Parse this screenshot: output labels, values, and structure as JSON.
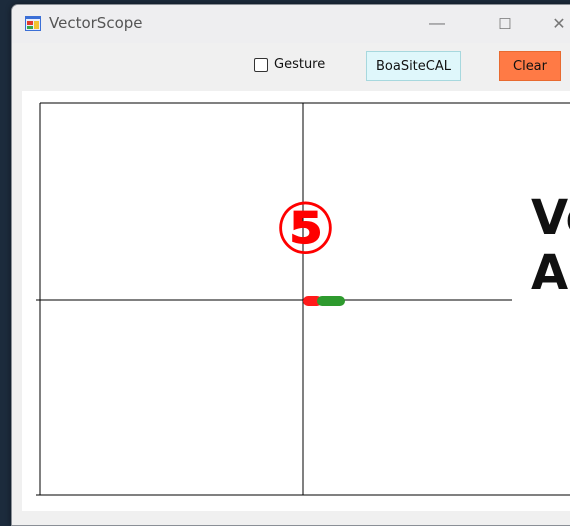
{
  "window": {
    "title": "VectorScope",
    "minimize_glyph": "—",
    "maximize_glyph": "☐",
    "close_glyph": "✕"
  },
  "toolbar": {
    "gesture_checkbox": {
      "label": "Gesture",
      "checked": false
    },
    "cal_button_label": "BoaSiteCAL",
    "clear_button_label": "Clear"
  },
  "overlay": {
    "step_number": "⑤",
    "heading_line1": "Ve",
    "heading_line2": "Ar"
  },
  "colors": {
    "step_number": "#ff0000",
    "marker_red": "#ff1a1a",
    "marker_green": "#2e9a2e",
    "clear_button": "#ff7a45",
    "cal_button": "#dff7fb"
  },
  "icons": {
    "app": "app-window-icon"
  }
}
